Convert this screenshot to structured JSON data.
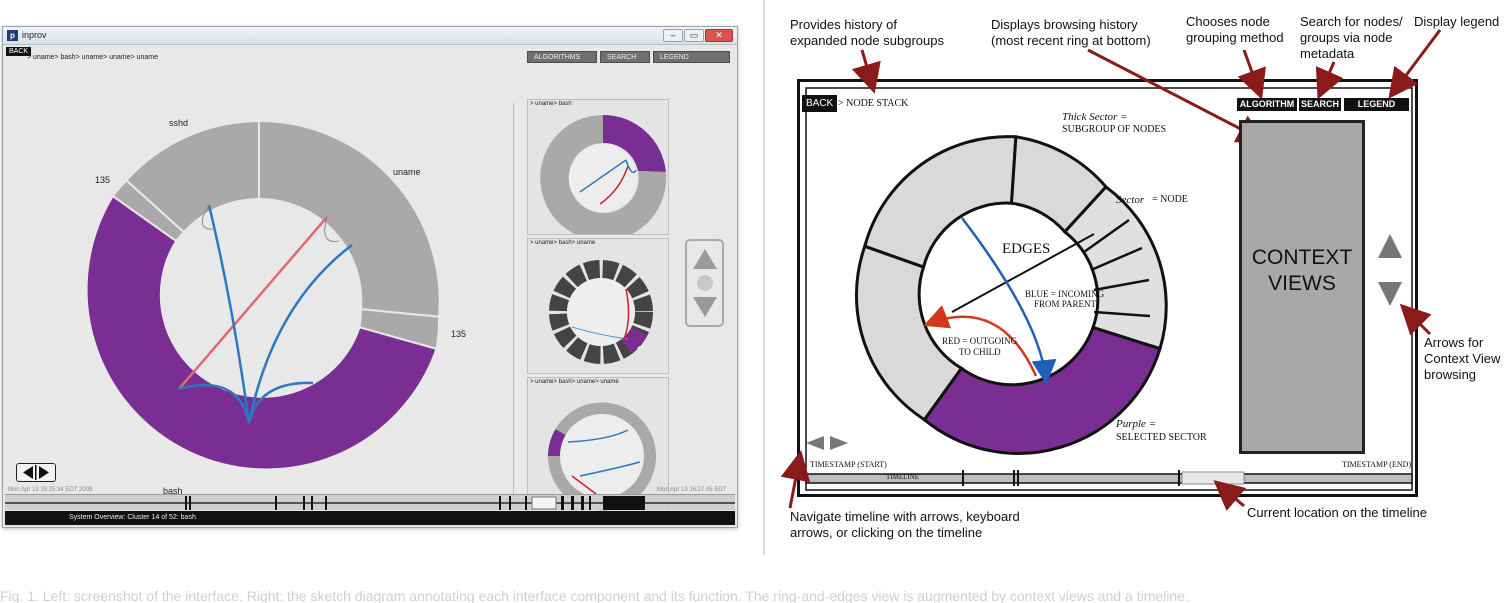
{
  "app": {
    "window_title": "inprov",
    "window_controls": {
      "minimize": "–",
      "maximize": "▭",
      "close": "✕"
    },
    "back_label": "BACK",
    "breadcrumb": "> uname> bash> uname> uname> uname",
    "buttons": {
      "algorithms": "ALGORITHMS",
      "search": "SEARCH",
      "legend": "LEGEND"
    },
    "ring_labels": {
      "sshd": "sshd",
      "n135_top": "135",
      "uname": "uname",
      "n135_right": "135",
      "bash": "bash"
    },
    "context_views": [
      {
        "label": "> uname> bash"
      },
      {
        "label": "> uname> bash> uname"
      },
      {
        "label": "> uname> bash> uname> uname"
      }
    ],
    "timestamp_start": "Mon Apr 13 15:25:34 EDT 2009",
    "timestamp_end": "Mon Apr 13 16:27:45 EDT",
    "status": "System Overview: Cluster 14 of 52: bash",
    "colors": {
      "purple": "#7a2e94",
      "gray": "#a9a9a9",
      "blue": "#2a78c4",
      "red": "#e06a70"
    }
  },
  "sketch": {
    "back_label": "BACK",
    "node_stack": "> NODE STACK",
    "buttons": {
      "algorithm": "ALGORITHM",
      "search": "SEARCH",
      "legend": "LEGEND"
    },
    "thick_sector_1": "Thick Sector =",
    "thick_sector_2": "subgroup of nodes",
    "sector_a": "Sector",
    "sector_b": " = node",
    "edges": "Edges",
    "blue_1": "Blue = Incoming",
    "blue_2": "from parent",
    "red_1": "Red = Outgoing",
    "red_2": "to child",
    "purple_1": "Purple =",
    "purple_2": "Selected sector",
    "context_1": "CONTEXT",
    "context_2": "VIEWS",
    "timeline": "TIMELINE",
    "timestamp_start": "TIMESTAMP (START)",
    "timestamp_end": "TIMESTAMP (END)"
  },
  "annotations": {
    "history_1": "Provides history of",
    "history_2": "expanded node subgroups",
    "browsing_1": "Displays browsing history",
    "browsing_2": "(most recent ring at bottom)",
    "grouping_1": "Chooses node",
    "grouping_2": "grouping method",
    "search_1": "Search for nodes/",
    "search_2": "groups via node",
    "search_3": "metadata",
    "legend": "Display legend",
    "arrows_1": "Arrows for",
    "arrows_2": "Context View",
    "arrows_3": "browsing",
    "navigate_1": "Navigate timeline with arrows, keyboard",
    "navigate_2": "arrows, or clicking on the timeline",
    "current": "Current location on the timeline"
  },
  "caption": "Fig. 1. Left: screenshot of the interface. Right: the sketch diagram annotating each interface component and its function. The ring-and-edges view is augmented by context views and a timeline."
}
